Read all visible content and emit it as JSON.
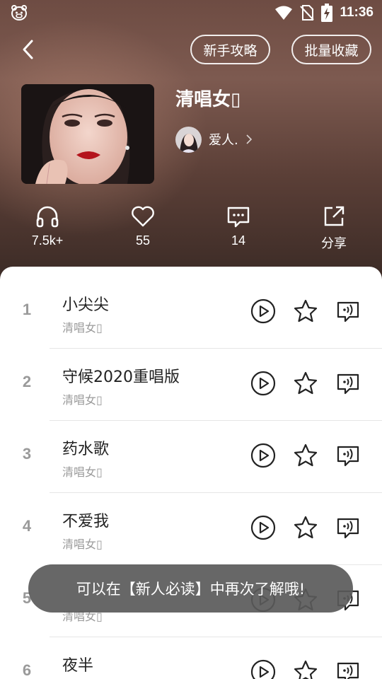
{
  "status_bar": {
    "time": "11:36",
    "icons": [
      "app-mascot-icon",
      "wifi-icon",
      "no-sim-icon",
      "battery-charging-icon"
    ]
  },
  "header": {
    "back_icon": "chevron-left-icon",
    "guide_button": "新手攻略",
    "batch_button": "批量收藏",
    "playlist_title": "清唱女▯",
    "creator_name": "爱人.",
    "creator_chevron": "chevron-right-icon"
  },
  "stats": {
    "listens": {
      "icon": "headphones-icon",
      "value": "7.5k+"
    },
    "likes": {
      "icon": "heart-icon",
      "value": "55"
    },
    "comments": {
      "icon": "comment-icon",
      "value": "14"
    },
    "share": {
      "icon": "share-icon",
      "value": "分享"
    }
  },
  "songs": [
    {
      "index": "1",
      "title": "小尖尖",
      "artist": "清唱女▯"
    },
    {
      "index": "2",
      "title": "守候2020重唱版",
      "artist": "清唱女▯"
    },
    {
      "index": "3",
      "title": "药水歌",
      "artist": "清唱女▯"
    },
    {
      "index": "4",
      "title": "不爱我",
      "artist": "清唱女▯"
    },
    {
      "index": "5",
      "title": "",
      "artist": "清唱女▯"
    },
    {
      "index": "6",
      "title": "夜半",
      "artist": ""
    }
  ],
  "row_actions": [
    "play-circle-icon",
    "star-icon",
    "ringtone-icon"
  ],
  "toast": {
    "text": "可以在【新人必读】中再次了解哦!"
  },
  "colors": {
    "header_gradient_top": "#7d5a50",
    "header_gradient_bottom": "#3a2a25",
    "secondary_text": "#9a9a9a",
    "primary_text": "#222222",
    "toast_background": "#5a5a5a"
  }
}
